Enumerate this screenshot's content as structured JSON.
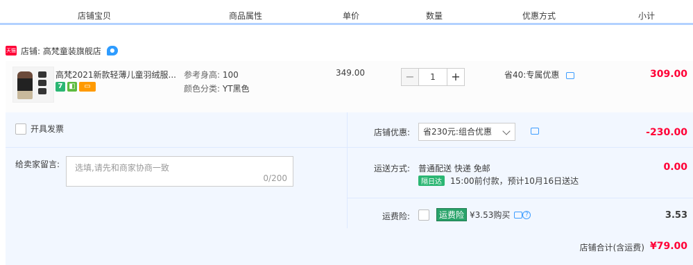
{
  "header": {
    "col_shop_item": "店铺宝贝",
    "col_attrs": "商品属性",
    "col_price": "单价",
    "col_qty": "数量",
    "col_discount": "优惠方式",
    "col_subtotal": "小计"
  },
  "shop": {
    "badge": "天猫",
    "name": "店铺: 高梵童装旗舰店"
  },
  "item": {
    "title": "高梵2021新款轻薄儿童羽绒服...",
    "attr_height_label": "参考身高:",
    "attr_height_value": "100",
    "attr_color_label": "颜色分类:",
    "attr_color_value": "YT黑色",
    "price": "349.00",
    "qty": "1",
    "qty_minus": "−",
    "qty_plus": "+",
    "discount": "省40:专属优惠",
    "subtotal": "309.00",
    "badge_seven": "7"
  },
  "invoice": {
    "label": "开具发票"
  },
  "message": {
    "label": "给卖家留言:",
    "placeholder": "选填,请先和商家协商一致",
    "count": "0/200"
  },
  "shop_discount": {
    "label": "店铺优惠:",
    "selected": "省230元:组合优惠",
    "amount": "-230.00"
  },
  "shipping": {
    "label": "运送方式:",
    "method": "普通配送 快递 免邮",
    "badge": "隔日达",
    "eta": "15:00前付款，预计10月16日送达",
    "amount": "0.00"
  },
  "insurance": {
    "label": "运费险:",
    "tag": "运费险",
    "price_text": "¥3.53购买",
    "amount": "3.53"
  },
  "total": {
    "label": "店铺合计(含运费)",
    "amount": "¥79.00"
  }
}
